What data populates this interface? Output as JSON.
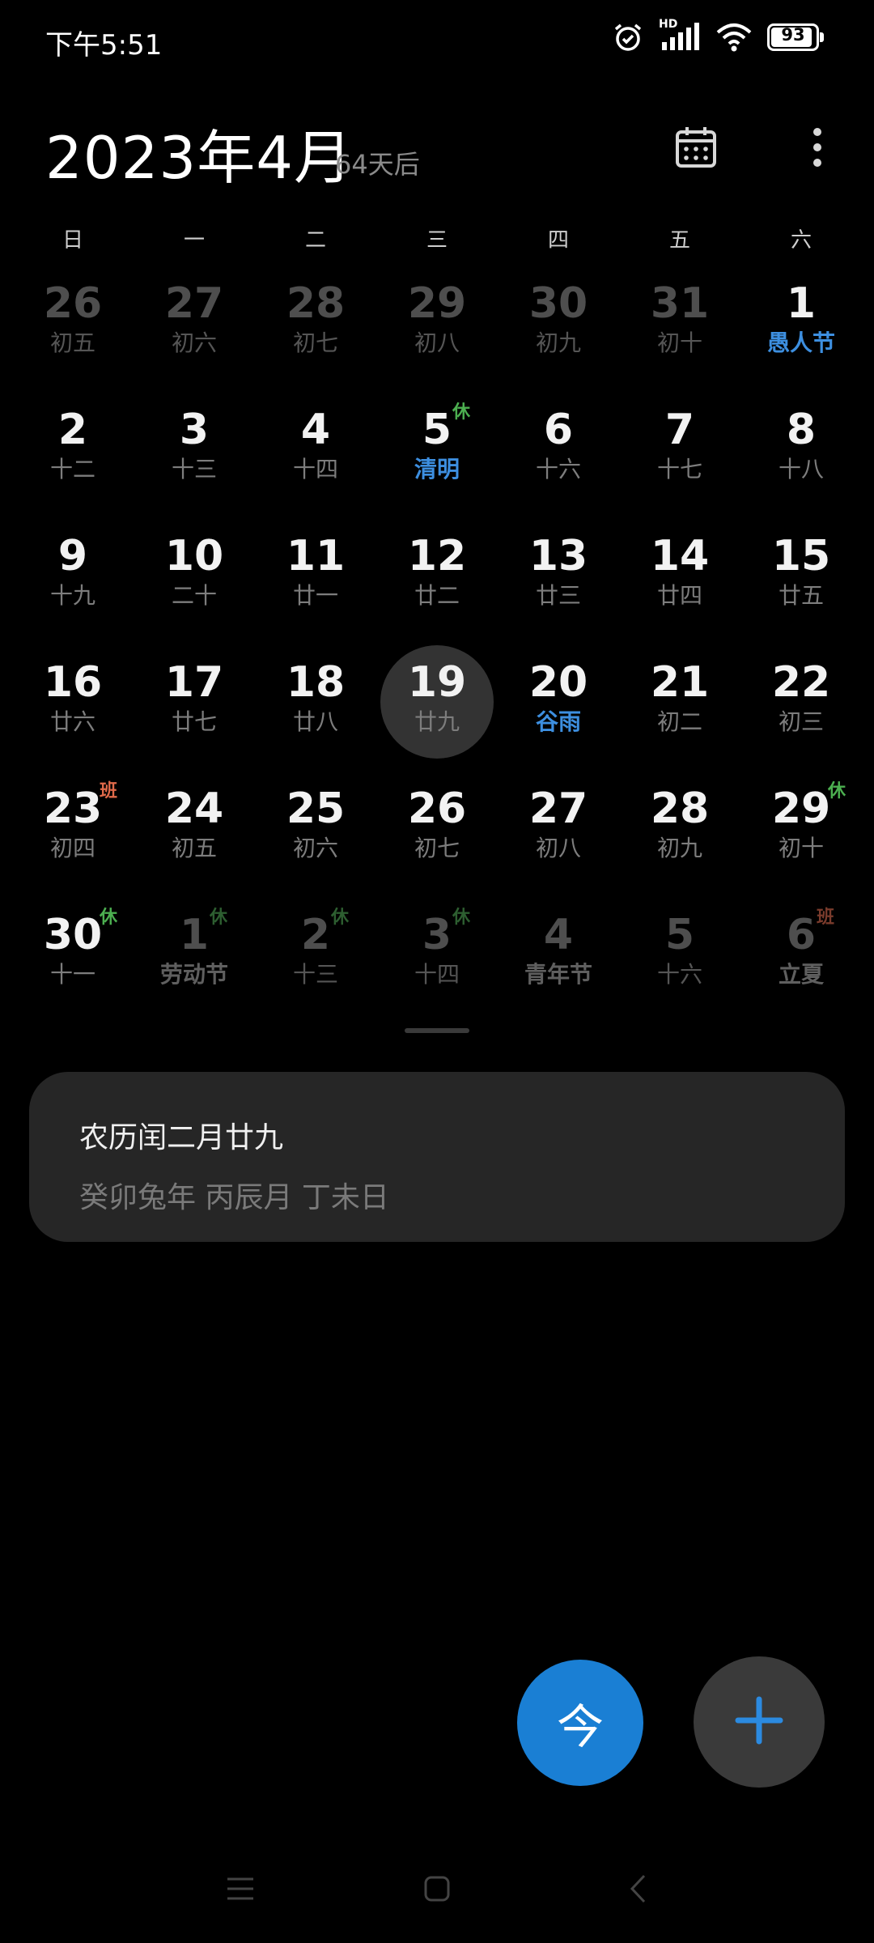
{
  "status_bar": {
    "time": "下午5:51",
    "network_label": "HD",
    "battery_level": 93,
    "battery_text": "93"
  },
  "header": {
    "month_title": "2023年4月",
    "countdown": "64天后",
    "calendar_icon": "calendar-icon",
    "more_icon": "more-vertical-icon"
  },
  "weekdays": [
    "日",
    "一",
    "二",
    "三",
    "四",
    "五",
    "六"
  ],
  "weeks": [
    [
      {
        "day": "26",
        "sub": "初五",
        "other": true
      },
      {
        "day": "27",
        "sub": "初六",
        "other": true
      },
      {
        "day": "28",
        "sub": "初七",
        "other": true
      },
      {
        "day": "29",
        "sub": "初八",
        "other": true
      },
      {
        "day": "30",
        "sub": "初九",
        "other": true
      },
      {
        "day": "31",
        "sub": "初十",
        "other": true
      },
      {
        "day": "1",
        "sub": "愚人节",
        "holiday": true
      }
    ],
    [
      {
        "day": "2",
        "sub": "十二"
      },
      {
        "day": "3",
        "sub": "十三"
      },
      {
        "day": "4",
        "sub": "十四"
      },
      {
        "day": "5",
        "sub": "清明",
        "holiday": true,
        "badge": "休",
        "badge_type": "rest"
      },
      {
        "day": "6",
        "sub": "十六"
      },
      {
        "day": "7",
        "sub": "十七"
      },
      {
        "day": "8",
        "sub": "十八"
      }
    ],
    [
      {
        "day": "9",
        "sub": "十九"
      },
      {
        "day": "10",
        "sub": "二十"
      },
      {
        "day": "11",
        "sub": "廿一"
      },
      {
        "day": "12",
        "sub": "廿二"
      },
      {
        "day": "13",
        "sub": "廿三"
      },
      {
        "day": "14",
        "sub": "廿四"
      },
      {
        "day": "15",
        "sub": "廿五"
      }
    ],
    [
      {
        "day": "16",
        "sub": "廿六"
      },
      {
        "day": "17",
        "sub": "廿七"
      },
      {
        "day": "18",
        "sub": "廿八"
      },
      {
        "day": "19",
        "sub": "廿九",
        "selected": true
      },
      {
        "day": "20",
        "sub": "谷雨",
        "holiday": true
      },
      {
        "day": "21",
        "sub": "初二"
      },
      {
        "day": "22",
        "sub": "初三"
      }
    ],
    [
      {
        "day": "23",
        "sub": "初四",
        "badge": "班",
        "badge_type": "work"
      },
      {
        "day": "24",
        "sub": "初五"
      },
      {
        "day": "25",
        "sub": "初六"
      },
      {
        "day": "26",
        "sub": "初七"
      },
      {
        "day": "27",
        "sub": "初八"
      },
      {
        "day": "28",
        "sub": "初九"
      },
      {
        "day": "29",
        "sub": "初十",
        "badge": "休",
        "badge_type": "rest"
      }
    ],
    [
      {
        "day": "30",
        "sub": "十一",
        "badge": "休",
        "badge_type": "rest"
      },
      {
        "day": "1",
        "sub": "劳动节",
        "other": true,
        "festival": true,
        "badge": "休",
        "badge_type": "rest"
      },
      {
        "day": "2",
        "sub": "十三",
        "other": true,
        "badge": "休",
        "badge_type": "rest"
      },
      {
        "day": "3",
        "sub": "十四",
        "other": true,
        "badge": "休",
        "badge_type": "rest"
      },
      {
        "day": "4",
        "sub": "青年节",
        "other": true,
        "festival": true
      },
      {
        "day": "5",
        "sub": "十六",
        "other": true
      },
      {
        "day": "6",
        "sub": "立夏",
        "other": true,
        "festival": true,
        "badge": "班",
        "badge_type": "work"
      }
    ]
  ],
  "info_card": {
    "lunar_date": "农历闰二月廿九",
    "ganzhi": "癸卯兔年 丙辰月 丁未日"
  },
  "fab": {
    "today_label": "今",
    "add_icon": "plus-icon"
  },
  "colors": {
    "accent": "#1a7fd4",
    "holiday_text": "#3d8fe0",
    "rest_badge": "#4caf50",
    "work_badge": "#e06a4a",
    "card_bg": "#262626"
  }
}
